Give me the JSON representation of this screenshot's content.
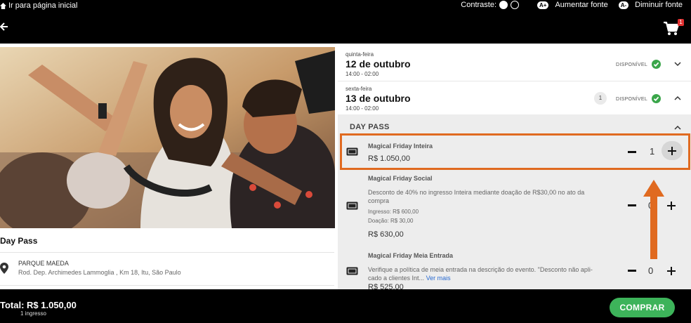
{
  "topbar": {
    "home_label": "Ir para página inicial",
    "contrast_label": "Contraste:",
    "increase_badge": "A+",
    "increase_label": "Aumentar fonte",
    "decrease_badge": "A-",
    "decrease_label": "Diminuir fonte"
  },
  "cart": {
    "badge": "1"
  },
  "event": {
    "title": "Day Pass",
    "location_name": "PARQUE MAEDA",
    "location_address": "Rod. Dep. Archimedes Lammoglia , Km 18, Itu, São Paulo"
  },
  "dates": [
    {
      "weekday": "quinta-feira",
      "date": "12 de outubro",
      "time": "14:00 - 02:00",
      "status": "DISPONÍVEL"
    },
    {
      "weekday": "sexta-feira",
      "date": "13 de outubro",
      "time": "14:00 - 02:00",
      "status": "DISPONÍVEL",
      "count": "1"
    }
  ],
  "section": {
    "title": "DAY PASS"
  },
  "tickets": [
    {
      "name": "Magical Friday Inteira",
      "price": "R$ 1.050,00",
      "qty": "1"
    },
    {
      "name": "Magical Friday Social",
      "desc1": "Desconto de 40% no ingresso Inteira mediante doação de R$30,00 no ato da",
      "desc2": "compra",
      "ingresso": "Ingresso: R$ 600,00",
      "doacao": "Doação: R$ 30,00",
      "price": "R$ 630,00",
      "qty": "0"
    },
    {
      "name": "Magical Friday Meia Entrada",
      "desc1": "Verifique a política de meia entrada na descrição do evento. \"Desconto não apli-",
      "desc2": "cado a clientes Int...",
      "more": "Ver mais",
      "price": "R$ 525,00",
      "qty": "0"
    }
  ],
  "footer": {
    "total": "Total: R$ 1.050,00",
    "count": "1 ingresso",
    "buy": "COMPRAR"
  },
  "colors": {
    "accent_green": "#3db35a",
    "highlight_orange": "#e06a20",
    "check_green": "#3aa64a"
  }
}
